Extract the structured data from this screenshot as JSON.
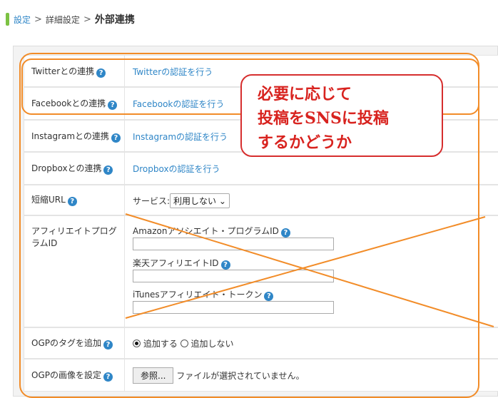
{
  "breadcrumb": {
    "items": [
      "設定",
      "詳細設定"
    ],
    "separator": ">",
    "current": "外部連携"
  },
  "rows": {
    "twitter": {
      "label": "Twitterとの連携",
      "link": "Twitterの認証を行う"
    },
    "facebook": {
      "label": "Facebookとの連携",
      "link": "Facebookの認証を行う"
    },
    "instagram": {
      "label": "Instagramとの連携",
      "link": "Instagramの認証を行う"
    },
    "dropbox": {
      "label": "Dropboxとの連携",
      "link": "Dropboxの認証を行う"
    },
    "short_url": {
      "label": "短縮URL",
      "service_label": "サービス:",
      "service_value": "利用しない"
    },
    "affiliate": {
      "label": "アフィリエイトプログラムID",
      "amazon_label": "Amazonアソシエイト・プログラムID",
      "amazon_value": "",
      "rakuten_label": "楽天アフィリエイトID",
      "rakuten_value": "",
      "itunes_label": "iTunesアフィリエイト・トークン",
      "itunes_value": ""
    },
    "ogp_tag": {
      "label": "OGPのタグを追加",
      "option_on": "追加する",
      "option_off": "追加しない",
      "selected": "追加する"
    },
    "ogp_image": {
      "label": "OGPの画像を設定",
      "button": "参照...",
      "status": "ファイルが選択されていません。"
    }
  },
  "help_icon": "?",
  "callout": {
    "lines": [
      "必要に応じて",
      "投稿をSNSに投稿",
      "するかどうか"
    ]
  },
  "colors": {
    "link": "#2f86c7",
    "annotation_orange": "#f28c28",
    "annotation_red": "#d8231f",
    "breadcrumb_bar": "#7cc243"
  }
}
